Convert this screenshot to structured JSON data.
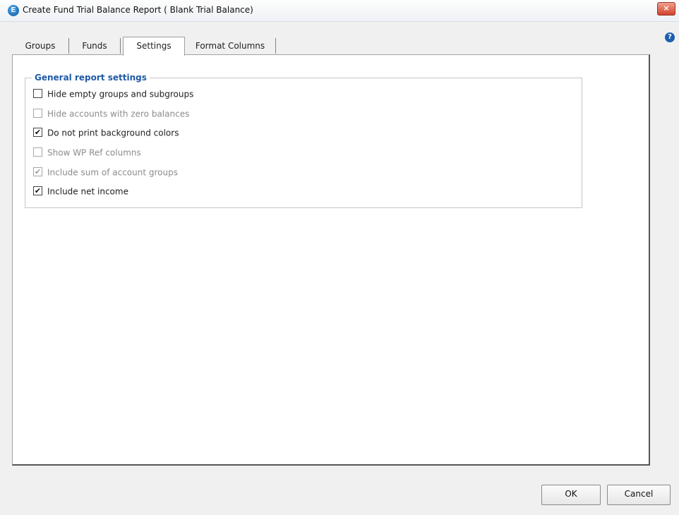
{
  "window": {
    "title": "Create Fund Trial Balance Report ( Blank Trial Balance)",
    "app_icon": "E",
    "close_symbol": "×",
    "help_symbol": "?"
  },
  "tabs": [
    {
      "label": "Groups",
      "active": false
    },
    {
      "label": "Funds",
      "active": false
    },
    {
      "label": "Settings",
      "active": true
    },
    {
      "label": "Format Columns",
      "active": false
    }
  ],
  "settings": {
    "group_title": "General report settings",
    "check_mark": "✔",
    "options": [
      {
        "label": "Hide empty groups and subgroups",
        "checked": false,
        "enabled": true
      },
      {
        "label": "Hide accounts with zero balances",
        "checked": false,
        "enabled": false
      },
      {
        "label": "Do not print background colors",
        "checked": true,
        "enabled": true
      },
      {
        "label": "Show WP Ref columns",
        "checked": false,
        "enabled": false
      },
      {
        "label": "Include sum of account groups",
        "checked": true,
        "enabled": false
      },
      {
        "label": "Include net income",
        "checked": true,
        "enabled": true
      }
    ]
  },
  "buttons": {
    "ok": "OK",
    "cancel": "Cancel"
  },
  "colors": {
    "legend_blue": "#1f5aa8",
    "disabled_text": "#8c8c8c"
  }
}
